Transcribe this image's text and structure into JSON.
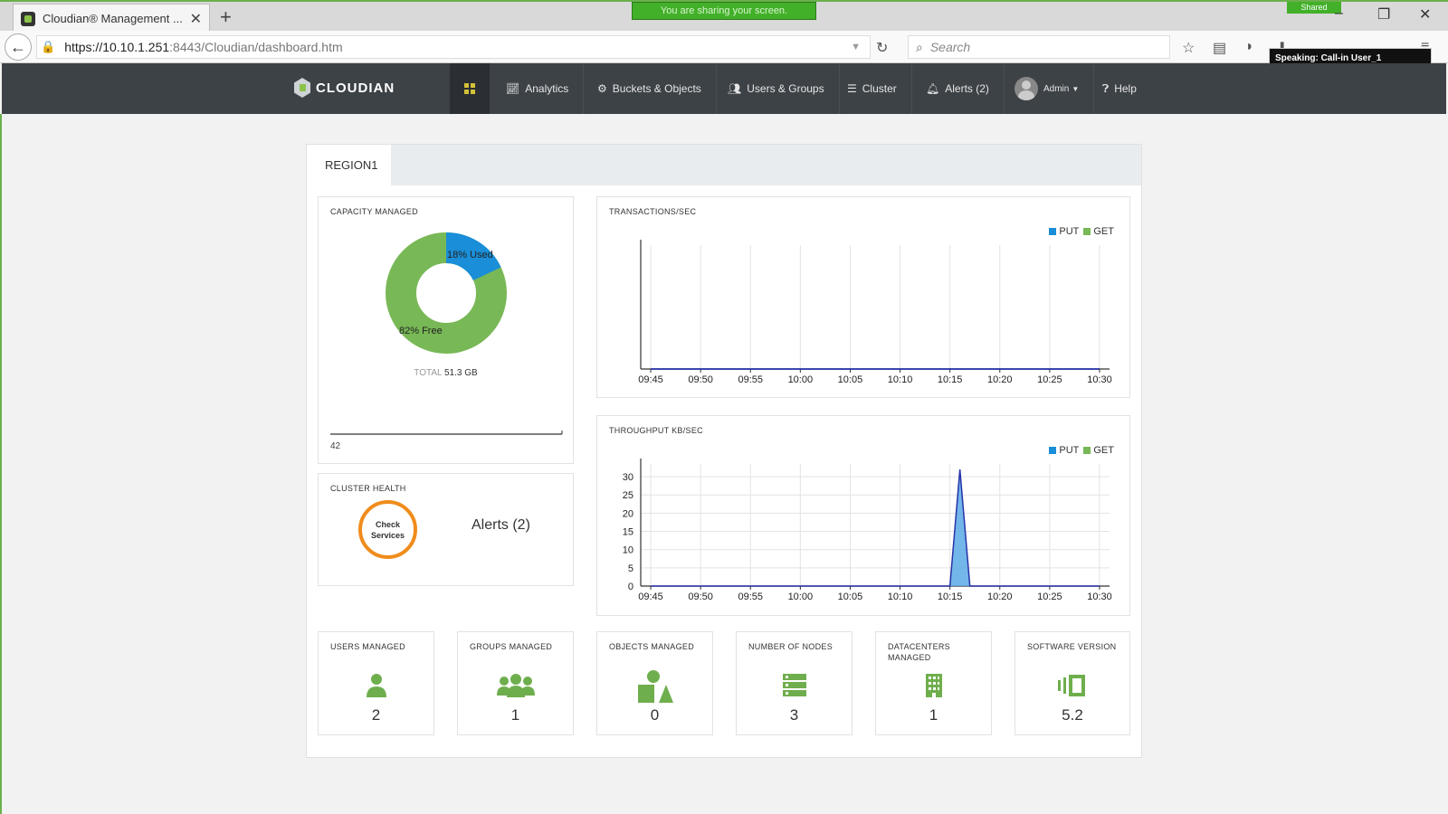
{
  "browser": {
    "tab_title": "Cloudian® Management ...",
    "share_banner": "You are sharing your screen.",
    "shared_tag": "Shared",
    "url_host": "https://10.10.1.251",
    "url_port_path": ":8443/Cloudian/dashboard.htm",
    "search_placeholder": "Search",
    "speaking": "Speaking: Call-in User_1"
  },
  "nav": {
    "logo": "CLOUDIAN",
    "analytics": "Analytics",
    "buckets": "Buckets & Objects",
    "users": "Users & Groups",
    "cluster": "Cluster",
    "alerts": "Alerts (2)",
    "admin": "Admin",
    "help": "Help"
  },
  "region": {
    "tab": "REGION1"
  },
  "capacity": {
    "title": "CAPACITY MANAGED",
    "used_label": "18% Used",
    "free_label": "82% Free",
    "used_pct": 18,
    "total_label": "TOTAL",
    "total_value": "51.3 GB",
    "spark_value": "42",
    "colors": {
      "used": "#1a8ed8",
      "free": "#78b856"
    }
  },
  "health": {
    "title": "CLUSTER HEALTH",
    "check_line1": "Check",
    "check_line2": "Services",
    "alerts": "Alerts (2)"
  },
  "kpis": [
    {
      "title": "USERS MANAGED",
      "value": "2",
      "icon": "user-icon"
    },
    {
      "title": "GROUPS MANAGED",
      "value": "1",
      "icon": "group-icon"
    },
    {
      "title": "OBJECTS MANAGED",
      "value": "0",
      "icon": "objects-icon"
    },
    {
      "title": "NUMBER OF NODES",
      "value": "3",
      "icon": "server-icon"
    },
    {
      "title": "DATACENTERS MANAGED",
      "value": "1",
      "icon": "building-icon"
    },
    {
      "title": "SOFTWARE VERSION",
      "value": "5.2",
      "icon": "version-icon"
    }
  ],
  "legend": {
    "put": "PUT",
    "get": "GET",
    "put_color": "#1a8ed8",
    "get_color": "#78b856"
  },
  "chart_data": [
    {
      "type": "area",
      "title": "TRANSACTIONS/SEC",
      "x": [
        "09:45",
        "09:50",
        "09:55",
        "10:00",
        "10:05",
        "10:10",
        "10:15",
        "10:20",
        "10:25",
        "10:30"
      ],
      "series": [
        {
          "name": "PUT",
          "values": [
            0,
            0,
            0,
            0,
            0,
            0,
            0,
            0,
            0,
            0
          ]
        },
        {
          "name": "GET",
          "values": [
            0,
            0,
            0,
            0,
            0,
            0,
            0,
            0,
            0,
            0
          ]
        }
      ],
      "yticks": [],
      "grid": true,
      "legend": "top-right"
    },
    {
      "type": "area",
      "title": "THROUGHPUT KB/SEC",
      "x": [
        "09:45",
        "09:50",
        "09:55",
        "10:00",
        "10:05",
        "10:10",
        "10:15",
        "10:20",
        "10:25",
        "10:30"
      ],
      "ylim": [
        0,
        33
      ],
      "yticks": [
        0,
        5,
        10,
        15,
        20,
        25,
        30
      ],
      "series": [
        {
          "name": "PUT",
          "points": [
            [
              "09:45",
              0
            ],
            [
              "10:15",
              0
            ],
            [
              "10:16",
              32
            ],
            [
              "10:17",
              0
            ],
            [
              "10:30",
              0
            ]
          ]
        }
      ],
      "grid": true,
      "legend": "top-right"
    }
  ]
}
